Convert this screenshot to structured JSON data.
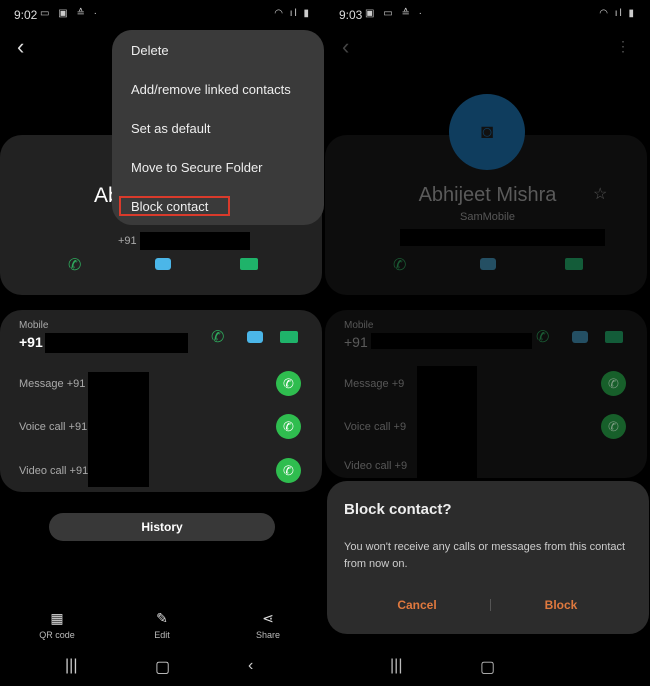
{
  "left": {
    "status_time": "9:02",
    "contact_name_partial": "Ab",
    "phone_prefix": "+91",
    "menu": {
      "items": [
        "Delete",
        "Add/remove linked contacts",
        "Set as default",
        "Move to Secure Folder",
        "Block contact"
      ],
      "highlighted": "Block contact",
      "highlight_color": "#d93a2b"
    },
    "mobile": {
      "label": "Mobile",
      "number_prefix": "+91"
    },
    "whatsapp_rows": [
      "Message +91",
      "Voice call +91",
      "Video call +91"
    ],
    "history_label": "History",
    "bottom": [
      {
        "label": "QR code",
        "icon": "qr-code-icon"
      },
      {
        "label": "Edit",
        "icon": "pencil-icon"
      },
      {
        "label": "Share",
        "icon": "share-icon"
      }
    ]
  },
  "right": {
    "status_time": "9:03",
    "contact_name": "Abhijeet Mishra",
    "company": "SamMobile",
    "mobile": {
      "label": "Mobile",
      "number_prefix": "+91"
    },
    "whatsapp_rows": [
      "Message +9",
      "Voice call +9",
      "Video call +9"
    ],
    "dialog": {
      "title": "Block contact?",
      "body": "You won't receive any calls or messages from this contact from now on.",
      "cancel": "Cancel",
      "confirm": "Block",
      "button_color": "#e0793e"
    }
  }
}
